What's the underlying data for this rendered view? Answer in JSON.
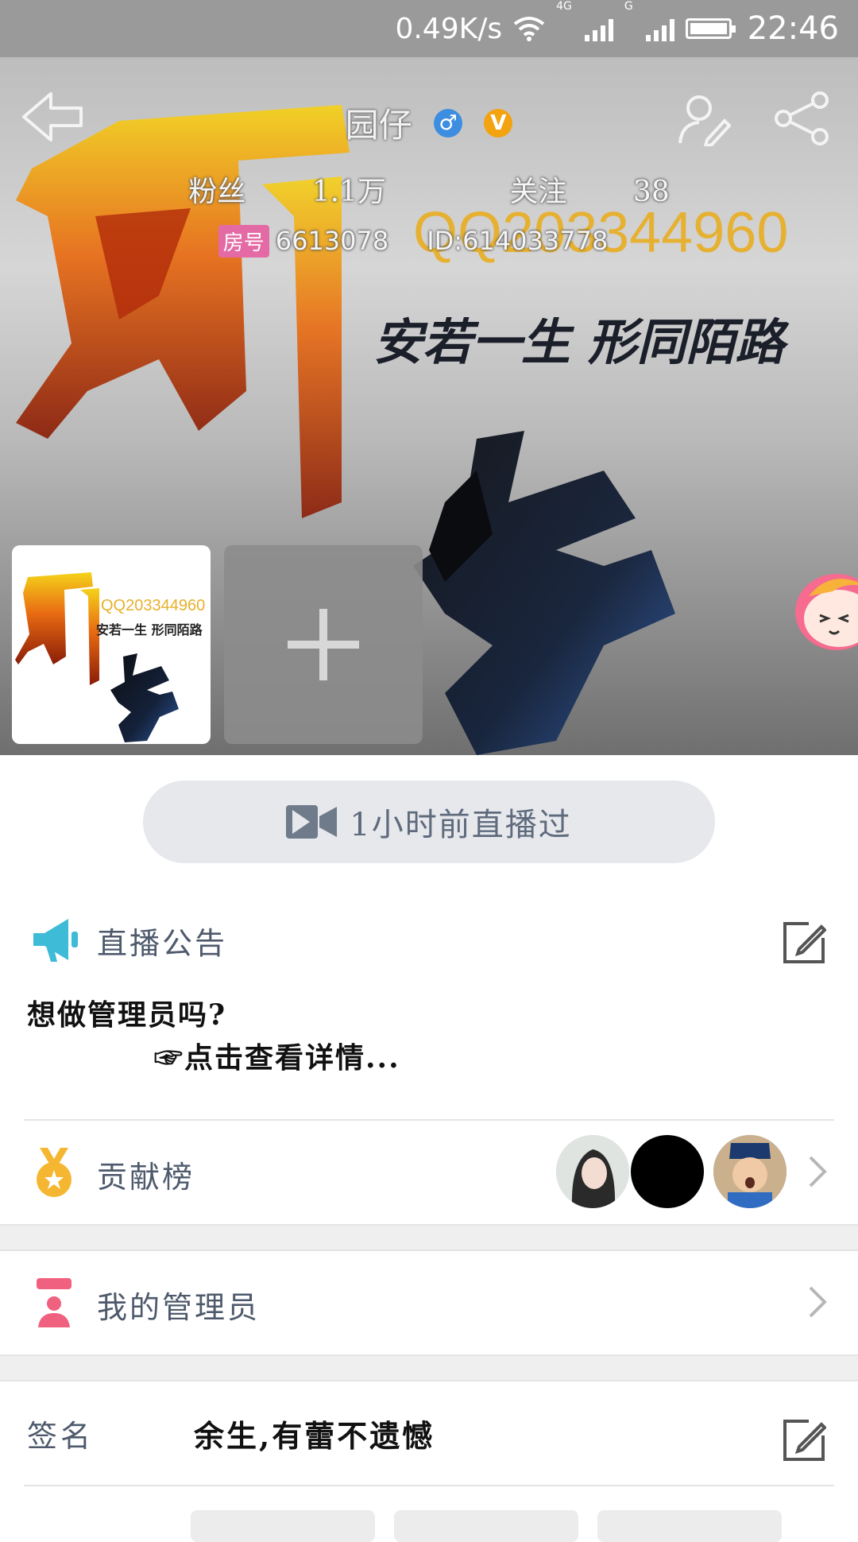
{
  "status_bar": {
    "speed": "0.49K/s",
    "net_label_1": "4G",
    "net_label_2": "G",
    "time": "22:46"
  },
  "profile": {
    "nickname": "园仔",
    "gender_symbol": "♂",
    "vip_symbol": "V",
    "fans_label": "粉丝",
    "fans_value": "1.1万",
    "follow_label": "关注",
    "follow_value": "38",
    "room_tag": "房号",
    "room_value": "6613078",
    "id_value": "ID:614033778"
  },
  "cover_text": {
    "qq": "QQ203344960",
    "slogan": "安若一生 形同陌路",
    "big_1": "园",
    "big_2": "仔"
  },
  "live": {
    "label": "1小时前直播过"
  },
  "announcement": {
    "title": "直播公告",
    "line1": "想做管理员吗?",
    "line2": "☞点击查看详情..."
  },
  "contribution": {
    "title": "贡献榜"
  },
  "admins": {
    "title": "我的管理员"
  },
  "signature": {
    "label": "签名",
    "value": "余生,有蕾不遗憾"
  },
  "colors": {
    "accent_blue": "#3ebbd6",
    "medal_gold": "#f5b731",
    "admin_pink": "#f0607f",
    "muted_text": "#4e5a6c"
  },
  "icons": [
    "back-arrow-icon",
    "edit-profile-icon",
    "share-icon",
    "video-camera-icon",
    "megaphone-icon",
    "edit-icon",
    "medal-icon",
    "admin-icon",
    "chevron-right-icon",
    "plus-icon"
  ]
}
